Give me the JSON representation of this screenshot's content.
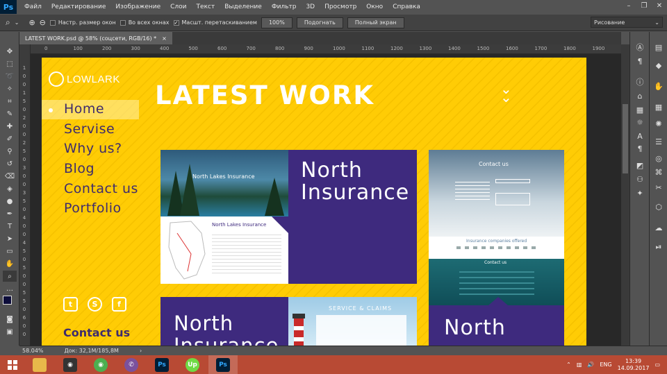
{
  "app": {
    "logo_text": "Ps"
  },
  "menu": [
    "Файл",
    "Редактирование",
    "Изображение",
    "Слои",
    "Текст",
    "Выделение",
    "Фильтр",
    "3D",
    "Просмотр",
    "Окно",
    "Справка"
  ],
  "options": {
    "resize_windows": "Настр. размер окон",
    "all_windows": "Во всех окнах",
    "scrubby_zoom": "Масшт. перетаскиванием",
    "zoom_value": "100%",
    "fit_label": "Подогнать",
    "fullscreen_label": "Полный экран",
    "workspace": "Рисование"
  },
  "document_tab": {
    "title": "LATEST WORK.psd @ 58% (соцсети, RGB/16) *",
    "close": "×"
  },
  "ruler_top": [
    "0",
    "100",
    "200",
    "300",
    "400",
    "500",
    "600",
    "700",
    "800",
    "900",
    "1000",
    "1100",
    "1200",
    "1300",
    "1400",
    "1500",
    "1600",
    "1700",
    "1800",
    "1900",
    "200"
  ],
  "ruler_left": [
    "1",
    "0",
    "0",
    "1",
    "5",
    "0",
    "2",
    "0",
    "0",
    "2",
    "5",
    "0",
    "3",
    "0",
    "0",
    "3",
    "5",
    "0",
    "4",
    "0",
    "0",
    "4",
    "5",
    "0",
    "5",
    "0",
    "0",
    "5",
    "5",
    "0",
    "6",
    "0",
    "0"
  ],
  "status": {
    "zoom": "58.04%",
    "doc_size": "Док: 32,1M/185,8M"
  },
  "taskbar": {
    "apps": [
      {
        "name": "file-explorer",
        "label": "",
        "color": "#e8b84a"
      },
      {
        "name": "obs",
        "label": "◉",
        "color": "#333333"
      },
      {
        "name": "chrome",
        "label": "◉",
        "color": "#4caf50"
      },
      {
        "name": "viber",
        "label": "✆",
        "color": "#7b519d"
      },
      {
        "name": "photoshop",
        "label": "Ps",
        "color": "#001e36"
      },
      {
        "name": "upwork",
        "label": "Up",
        "color": "#6fda44"
      },
      {
        "name": "photoshop-2",
        "label": "Ps",
        "color": "#001e36"
      }
    ],
    "lang": "ENG",
    "time": "13:39",
    "date": "14.09.2017"
  },
  "design": {
    "brand": "LOWLARK",
    "heading": "LATEST WORK",
    "nav": [
      "Home",
      "Servise",
      "Why us?",
      "Blog",
      "Contact us",
      "Portfolio"
    ],
    "cards": {
      "card1_overlay_title": "North Lakes Insurance",
      "card1_subtitle": "North Lakes Insurance",
      "card1_title": "North Insurance",
      "card2_heading": "Contact us",
      "card2_partners": "Insurance companies offered",
      "card2_contact": "Contact us",
      "card2_title": "North",
      "card3_title": "North Insurance",
      "card3_service": "SERVICE & CLAIMS"
    },
    "contact_title": "Contact us"
  },
  "colors": {
    "yellow": "#ffcc05",
    "purple": "#3e2a7e",
    "nav_text": "#3e2b6d",
    "ps_blue": "#31a8ff",
    "taskbar": "#b84a34"
  }
}
